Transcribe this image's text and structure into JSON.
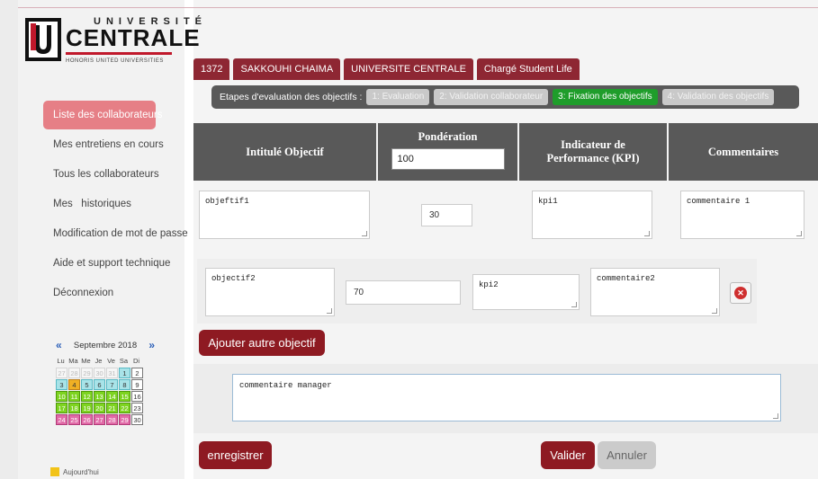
{
  "logo": {
    "univ": "UNIVERSITÉ",
    "centrale": "CENTRALE",
    "tagline": "HONORIS UNITED UNIVERSITIES"
  },
  "sidebar": {
    "items": [
      {
        "label": "Liste des collaborateurs",
        "active": true
      },
      {
        "label": "Mes entretiens en cours",
        "active": false
      },
      {
        "label": "Tous les collaborateurs",
        "active": false
      },
      {
        "label": "Mes   historiques",
        "active": false
      },
      {
        "label": "Modification de mot de passe",
        "active": false
      },
      {
        "label": "Aide et support technique",
        "active": false
      },
      {
        "label": "Déconnexion",
        "active": false
      }
    ]
  },
  "calendar": {
    "prev": "«",
    "next": "»",
    "month": "Septembre 2018",
    "days": [
      "Lu",
      "Ma",
      "Me",
      "Je",
      "Ve",
      "Sa",
      "Di"
    ],
    "weeks": [
      [
        "27",
        "28",
        "29",
        "30",
        "31",
        "1",
        "2"
      ],
      [
        "3",
        "4",
        "5",
        "6",
        "7",
        "8",
        "9"
      ],
      [
        "10",
        "11",
        "12",
        "13",
        "14",
        "15",
        "16"
      ],
      [
        "17",
        "18",
        "19",
        "20",
        "21",
        "22",
        "23"
      ],
      [
        "24",
        "25",
        "26",
        "27",
        "28",
        "29",
        "30"
      ]
    ],
    "legend": "Aujourd'hui"
  },
  "info_tabs": [
    "1372",
    "SAKKOUHI CHAIMA",
    "UNIVERSITE CENTRALE",
    "Chargé Student Life"
  ],
  "steps": {
    "label": "Etapes d'evaluation des objectifs :",
    "items": [
      {
        "label": "1: Evaluation",
        "current": false
      },
      {
        "label": "2: Validation collaborateur",
        "current": false
      },
      {
        "label": "3: Fixation des objectifs",
        "current": true
      },
      {
        "label": "4: Validation des objectifs",
        "current": false
      }
    ]
  },
  "table": {
    "headers": {
      "intitule": "Intitulé Objectif",
      "ponderation": "Pondération",
      "kpi": "Indicateur de Performance (KPI)",
      "commentaires": "Commentaires"
    },
    "ponderation_total": "100",
    "rows": [
      {
        "objectif": "objeftif1",
        "ponderation": "30",
        "kpi": "kpi1",
        "commentaire": "commentaire 1"
      },
      {
        "objectif": "objectif2",
        "ponderation": "70",
        "kpi": "kpi2",
        "commentaire": "commentaire2"
      }
    ]
  },
  "buttons": {
    "add_objective": "Ajouter autre objectif",
    "save": "enregistrer",
    "validate": "Valider",
    "cancel": "Annuler",
    "delete_symbol": "✕"
  },
  "manager_comment": "commentaire manager",
  "colors": {
    "brand": "#8e1a22",
    "active_menu": "#e67f86",
    "current_step": "#1f9d2b",
    "header_bg": "#595959"
  }
}
